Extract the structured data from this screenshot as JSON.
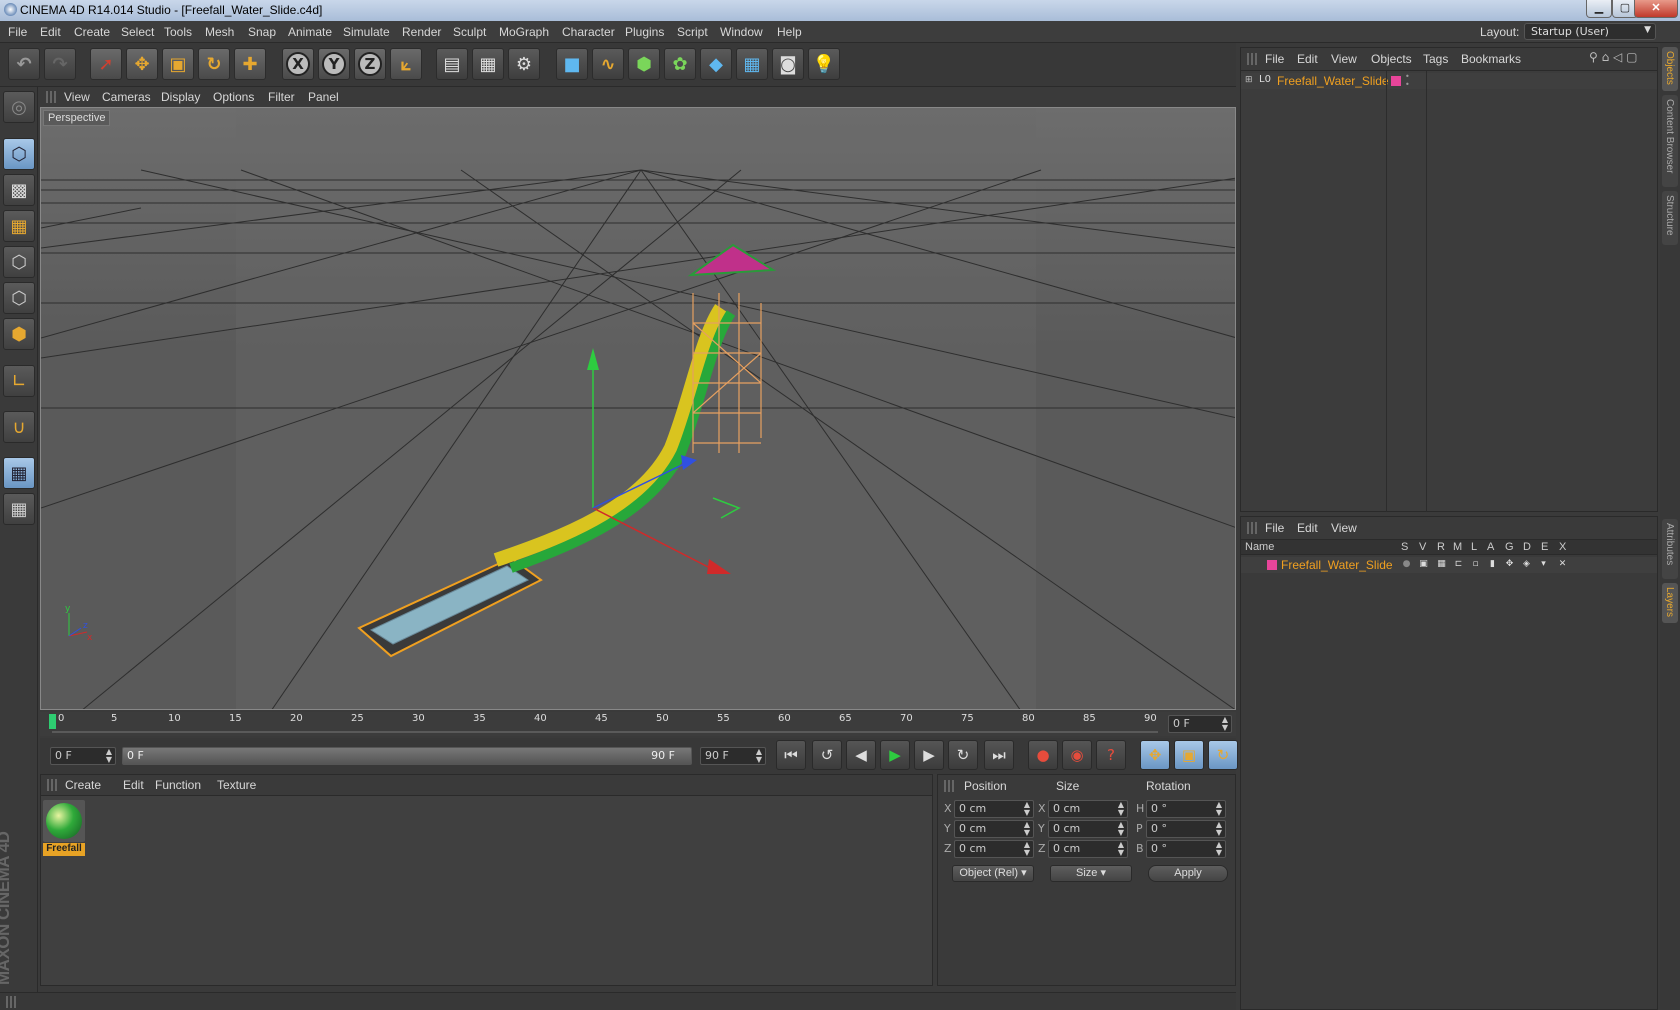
{
  "window": {
    "title": "CINEMA 4D R14.014 Studio - [Freefall_Water_Slide.c4d]",
    "min": "▁",
    "max": "▢",
    "close": "✕"
  },
  "menu": [
    "File",
    "Edit",
    "Create",
    "Select",
    "Tools",
    "Mesh",
    "Snap",
    "Animate",
    "Simulate",
    "Render",
    "Sculpt",
    "MoGraph",
    "Character",
    "Plugins",
    "Script",
    "Window",
    "Help"
  ],
  "layout": {
    "label": "Layout:",
    "value": "Startup (User)"
  },
  "toolbar": {
    "x": "X",
    "y": "Y",
    "z": "Z"
  },
  "viewport": {
    "menu": [
      "View",
      "Cameras",
      "Display",
      "Options",
      "Filter",
      "Panel"
    ],
    "label": "Perspective",
    "axis_y": "y",
    "axis_z": "z",
    "axis_x": "x"
  },
  "timeline": {
    "ticks": [
      "0",
      "5",
      "10",
      "15",
      "20",
      "25",
      "30",
      "35",
      "40",
      "45",
      "50",
      "55",
      "60",
      "65",
      "70",
      "75",
      "80",
      "85",
      "90"
    ],
    "current": "0 F"
  },
  "transport": {
    "start": "0 F",
    "range_start": "0 F",
    "range_end": "90 F",
    "end": "90 F"
  },
  "material_manager": {
    "menu": [
      "Create",
      "Edit",
      "Function",
      "Texture"
    ],
    "material": "Freefall"
  },
  "coordinates": {
    "headers": {
      "position": "Position",
      "size": "Size",
      "rotation": "Rotation"
    },
    "rows": [
      {
        "axis": "X",
        "pos": "0 cm",
        "size": "0 cm",
        "rot_label": "H",
        "rot": "0 °"
      },
      {
        "axis": "Y",
        "pos": "0 cm",
        "size": "0 cm",
        "rot_label": "P",
        "rot": "0 °"
      },
      {
        "axis": "Z",
        "pos": "0 cm",
        "size": "0 cm",
        "rot_label": "B",
        "rot": "0 °"
      }
    ],
    "mode": "Object (Rel)",
    "size_mode": "Size",
    "apply": "Apply"
  },
  "object_manager": {
    "menu": [
      "File",
      "Edit",
      "View",
      "Objects",
      "Tags",
      "Bookmarks"
    ],
    "object": "Freefall_Water_Slide",
    "object_color": "#e8459a"
  },
  "layer_manager": {
    "menu": [
      "File",
      "Edit",
      "View"
    ],
    "columns": [
      "Name",
      "S",
      "V",
      "R",
      "M",
      "L",
      "A",
      "G",
      "D",
      "E",
      "X"
    ],
    "layer": "Freefall_Water_Slide",
    "layer_color": "#e8459a"
  },
  "side_tabs": {
    "objects": "Objects",
    "content": "Content Browser",
    "structure": "Structure",
    "attributes": "Attributes",
    "layers": "Layers"
  },
  "brand": "MAXON CINEMA 4D",
  "colors": {
    "accent": "#e6a830",
    "selected": "#f0a020"
  }
}
